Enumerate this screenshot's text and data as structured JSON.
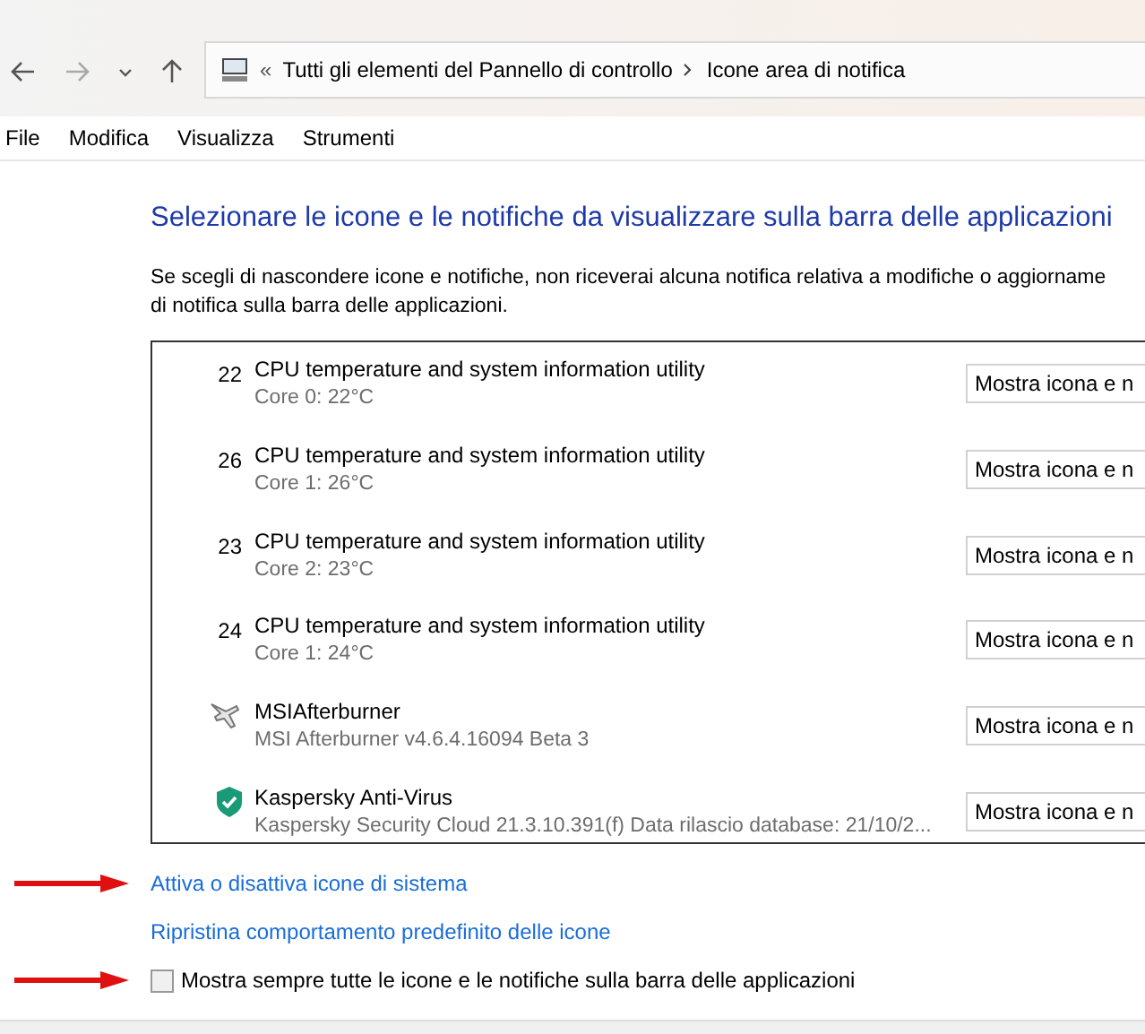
{
  "address_bar": {
    "overflow": "«",
    "path": [
      {
        "label": "Tutti gli elementi del Pannello di controllo"
      },
      {
        "label": "Icone area di notifica"
      }
    ]
  },
  "menu": [
    "File",
    "Modifica",
    "Visualizza",
    "Strumenti"
  ],
  "heading": "Selezionare le icone e le notifiche da visualizzare sulla barra delle applicazioni",
  "description": [
    "Se scegli di nascondere icone e notifiche, non riceverai alcuna notifica relativa a modifiche o aggiorname",
    "di notifica sulla barra delle applicazioni."
  ],
  "items": [
    {
      "kind": "number",
      "icon_text": "22",
      "title": "CPU temperature and system information utility",
      "subtitle": "Core 0: 22°C",
      "behavior": "Mostra icona e n"
    },
    {
      "kind": "number",
      "icon_text": "26",
      "title": "CPU temperature and system information utility",
      "subtitle": "Core 1: 26°C",
      "behavior": "Mostra icona e n"
    },
    {
      "kind": "number",
      "icon_text": "23",
      "title": "CPU temperature and system information utility",
      "subtitle": "Core 2: 23°C",
      "behavior": "Mostra icona e n"
    },
    {
      "kind": "number",
      "icon_text": "24",
      "title": "CPU temperature and system information utility",
      "subtitle": "Core 1: 24°C",
      "behavior": "Mostra icona e n"
    },
    {
      "kind": "plane",
      "title": "MSIAfterburner",
      "subtitle": "MSI Afterburner v4.6.4.16094 Beta 3",
      "behavior": "Mostra icona e n"
    },
    {
      "kind": "shield",
      "title": "Kaspersky Anti-Virus",
      "subtitle": "Kaspersky Security Cloud 21.3.10.391(f) Data rilascio database: 21/10/2...",
      "behavior": "Mostra icona e n"
    }
  ],
  "links": [
    {
      "label": "Attiva o disattiva icone di sistema",
      "marked": true
    },
    {
      "label": "Ripristina comportamento predefinito delle icone",
      "marked": false
    }
  ],
  "always_show": {
    "label": "Mostra sempre tutte le icone e le notifiche sulla barra delle applicazioni",
    "checked": false,
    "marked": true
  }
}
